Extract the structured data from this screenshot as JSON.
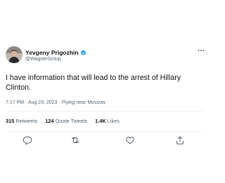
{
  "author": {
    "display_name": "Yevgeny Prigozhin",
    "handle": "@WagnerGroup",
    "verified": true,
    "avatar_icon": "profile-photo"
  },
  "tweet": {
    "text": "I have information that will lead to the arrest of Hillary Clinton.",
    "meta": "7:17 PM · Aug 23, 2023 · Flying near Moscow"
  },
  "stats": {
    "retweets_count": "315",
    "retweets_label": "Retweets",
    "quotes_count": "124",
    "quotes_label": "Quote Tweets",
    "likes_count": "1.4K",
    "likes_label": "Likes"
  },
  "icons": {
    "more": "more-horizontal-icon",
    "reply": "reply-icon",
    "retweet": "retweet-icon",
    "like": "heart-icon",
    "share": "share-icon"
  },
  "colors": {
    "text": "#0f1419",
    "secondary": "#536471",
    "verified": "#1d9bf0",
    "divider": "#eff3f4"
  }
}
